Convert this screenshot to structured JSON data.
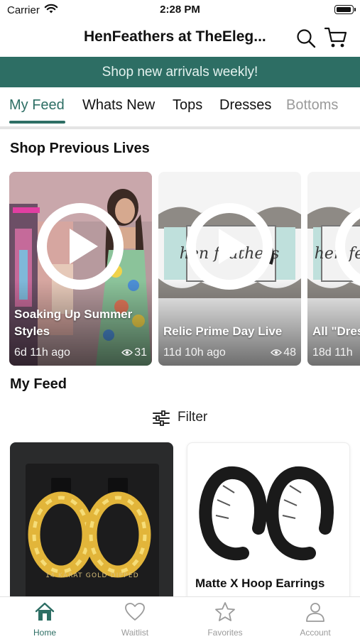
{
  "status_bar": {
    "carrier": "Carrier",
    "time": "2:28 PM"
  },
  "header": {
    "title": "HenFeathers at TheEleg...",
    "search_icon": "search-icon",
    "cart_icon": "cart-icon"
  },
  "banner": {
    "text": "Shop new arrivals weekly!"
  },
  "tabs": [
    {
      "label": "My Feed",
      "selected": true
    },
    {
      "label": "Whats New"
    },
    {
      "label": "Tops"
    },
    {
      "label": "Dresses"
    },
    {
      "label": "Bottoms"
    }
  ],
  "previous_lives": {
    "heading": "Shop Previous Lives",
    "items": [
      {
        "title": "Soaking Up Summer Styles",
        "age": "6d 11h ago",
        "views": "31"
      },
      {
        "title": "Relic Prime Day Live",
        "age": "11d 10h ago",
        "views": "48"
      },
      {
        "title": "All \"Dres",
        "age": "18d 11h"
      }
    ]
  },
  "feed": {
    "heading": "My Feed",
    "filter_label": "Filter",
    "products": [
      {
        "name": "",
        "box_text": "14 KARAT GOLD DIPPED"
      },
      {
        "name": "Matte X Hoop Earrings"
      }
    ]
  },
  "bottom_nav": [
    {
      "label": "Home",
      "icon": "home-icon",
      "active": true
    },
    {
      "label": "Waitlist",
      "icon": "heart-icon"
    },
    {
      "label": "Favorites",
      "icon": "star-icon"
    },
    {
      "label": "Account",
      "icon": "person-icon"
    }
  ],
  "colors": {
    "brand": "#2d6e64",
    "banner_text": "#e4f2ef",
    "inactive": "#9b9b9b"
  }
}
